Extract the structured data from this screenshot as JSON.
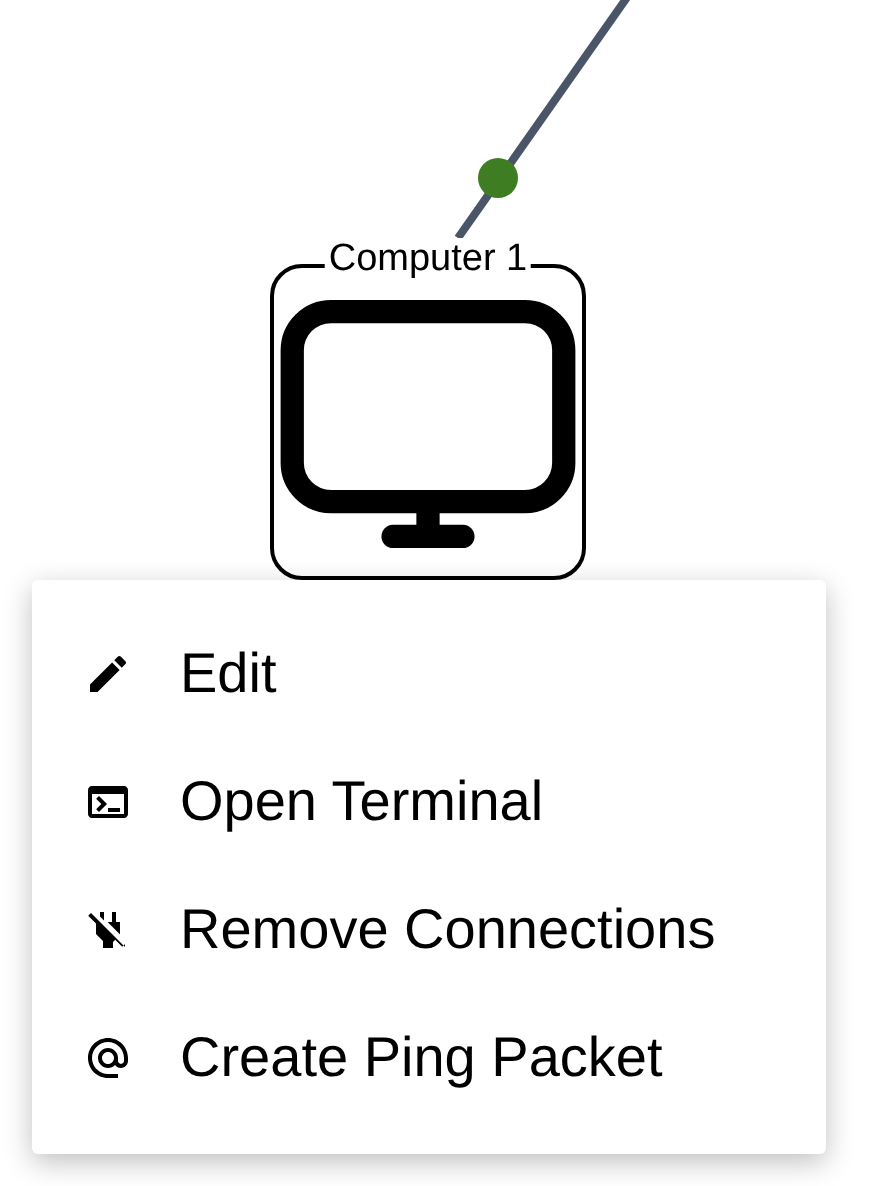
{
  "node": {
    "label": "Computer 1"
  },
  "context_menu": {
    "items": [
      {
        "label": "Edit"
      },
      {
        "label": "Open Terminal"
      },
      {
        "label": "Remove Connections"
      },
      {
        "label": "Create Ping Packet"
      }
    ]
  }
}
